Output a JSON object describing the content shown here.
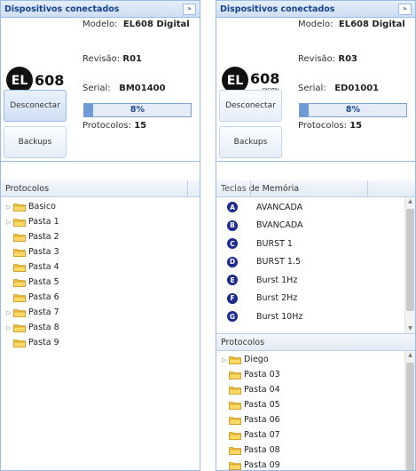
{
  "left": {
    "title": "Dispositivos conectados",
    "collapse_icon": "»",
    "logo_text": "608",
    "logo_sub": "",
    "model_label": "Modelo:",
    "model_value": "EL608 Digital",
    "revision_label": "Revisão:",
    "revision_value": "R01",
    "serial_label": "Serial:",
    "serial_value": "BM01400",
    "progress_text": "8%",
    "progress_value": 0.08,
    "protocols_label": "Protocolos:",
    "protocols_value": "15",
    "disconnect_label": "Desconectar",
    "backups_label": "Backups",
    "tree_header": "Protocolos",
    "tree": [
      {
        "label": "Basico",
        "expandable": true
      },
      {
        "label": "Pasta 1",
        "expandable": true
      },
      {
        "label": "Pasta 2",
        "expandable": false
      },
      {
        "label": "Pasta 3",
        "expandable": false
      },
      {
        "label": "Pasta 4",
        "expandable": false
      },
      {
        "label": "Pasta 5",
        "expandable": false
      },
      {
        "label": "Pasta 6",
        "expandable": false
      },
      {
        "label": "Pasta 7",
        "expandable": true
      },
      {
        "label": "Pasta 8",
        "expandable": true
      },
      {
        "label": "Pasta 9",
        "expandable": false
      }
    ]
  },
  "right": {
    "title": "Dispositivos conectados",
    "collapse_icon": "»",
    "logo_text": "608",
    "logo_sub": "DIGITAL",
    "model_label": "Modelo:",
    "model_value": "EL608 Digital",
    "revision_label": "Revisão:",
    "revision_value": "R03",
    "serial_label": "Serial:",
    "serial_value": "ED01001",
    "progress_text": "8%",
    "progress_value": 0.08,
    "protocols_label": "Protocolos:",
    "protocols_value": "15",
    "disconnect_label": "Desconectar",
    "backups_label": "Backups",
    "keys_header_a": "Teclas",
    "keys_header_b": " de Memória",
    "keys": [
      {
        "letter": "A",
        "label": "AVANCADA"
      },
      {
        "letter": "B",
        "label": "BVANCADA"
      },
      {
        "letter": "C",
        "label": "BURST 1"
      },
      {
        "letter": "D",
        "label": "BURST 1.5"
      },
      {
        "letter": "E",
        "label": "Burst 1Hz"
      },
      {
        "letter": "F",
        "label": "Burst 2Hz"
      },
      {
        "letter": "G",
        "label": "Burst 10Hz"
      }
    ],
    "tree_header": "Protocolos",
    "tree": [
      {
        "label": "Diego",
        "expandable": true
      },
      {
        "label": "Pasta 03",
        "expandable": false
      },
      {
        "label": "Pasta 04",
        "expandable": false
      },
      {
        "label": "Pasta 05",
        "expandable": false
      },
      {
        "label": "Pasta 06",
        "expandable": false
      },
      {
        "label": "Pasta 07",
        "expandable": false
      },
      {
        "label": "Pasta 08",
        "expandable": false
      },
      {
        "label": "Pasta 09",
        "expandable": false
      }
    ]
  },
  "colors": {
    "title": "#15428b",
    "accent": "#99bbe8",
    "progress_fill": "#6e9ad8",
    "key_badge": "#1b2a8c",
    "folder": "#f5c542"
  },
  "icons": {
    "folder": "folder-icon",
    "expand": "triangle-right-icon",
    "collapse": "double-chevron-right-icon"
  }
}
